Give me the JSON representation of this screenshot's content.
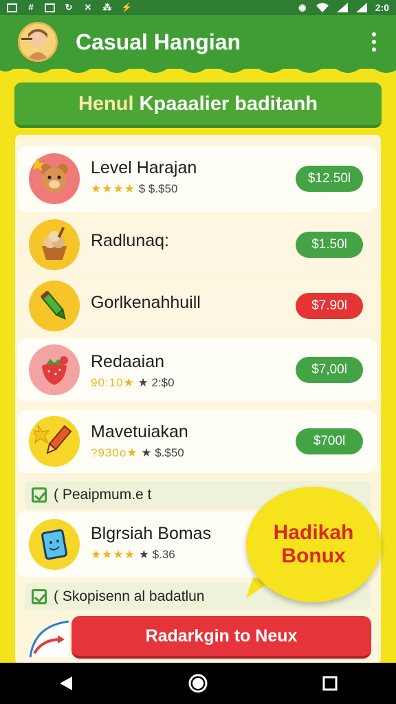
{
  "status_bar": {
    "time": "2:0",
    "left_icons": [
      "grid-icon",
      "hash-icon",
      "image-icon",
      "sync-icon",
      "tools-icon",
      "grid2-icon",
      "bolt-icon"
    ],
    "right_icons": [
      "alarm-icon",
      "wifi-icon",
      "signal-icon",
      "battery-icon"
    ]
  },
  "header": {
    "title": "Casual Hangian",
    "bg_color": "#3f9d34"
  },
  "banner": {
    "accent_text": "Henul",
    "text": "Kpaaalier baditanh"
  },
  "items": [
    {
      "name": "Level Harajan",
      "rating_prefix": "★★★★",
      "rating_text": " $ $.$50",
      "price": "$12.50l",
      "price_color": "green",
      "icon": "teddy-bear-icon"
    },
    {
      "name": "Radlunaq:",
      "price": "$1.50l",
      "price_color": "green",
      "icon": "sundae-icon"
    },
    {
      "name": "Gorlkenahhuill",
      "price": "$7.90l",
      "price_color": "red",
      "icon": "crayon-icon"
    },
    {
      "name": "Redaaian",
      "rating_prefix": "90:10★",
      "rating_text": " ★ 2:$0",
      "price": "$7,00l",
      "price_color": "green",
      "icon": "strawberry-icon"
    },
    {
      "name": "Mavetuiakan",
      "rating_prefix": "?930o★",
      "rating_text": " ★ $.$50",
      "price": "$700l",
      "price_color": "green",
      "icon": "rocket-pencil-icon"
    },
    {
      "name": "Blgrsiah Bomas",
      "rating_prefix": "★★★★",
      "rating_text": " ★ $.36",
      "icon": "tablet-icon"
    }
  ],
  "sections": [
    {
      "label": "( Peaipmum.e t"
    },
    {
      "label": "( Skopisenn al badatlun"
    }
  ],
  "bonus_bubble": {
    "line1": "Hadikah",
    "line2": "Bonux"
  },
  "cta": {
    "label": "Radarkgin to Neux"
  },
  "colors": {
    "accent_green": "#43a345",
    "accent_red": "#e53434",
    "background_yellow": "#f4e21a"
  }
}
